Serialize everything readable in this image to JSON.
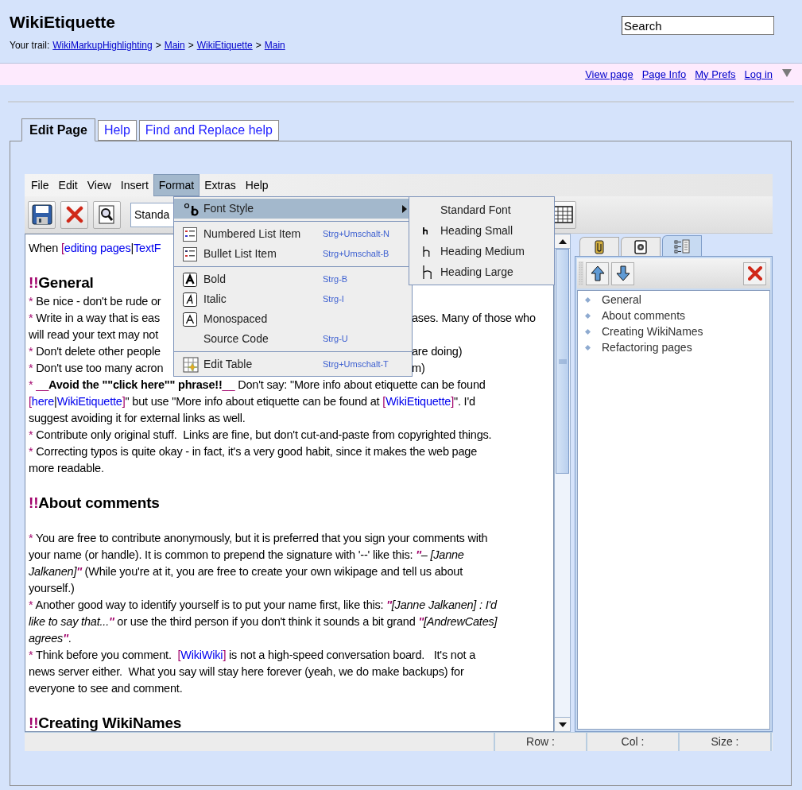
{
  "header": {
    "title": "WikiEtiquette",
    "search": {
      "value": "Search"
    }
  },
  "trail": {
    "label": "Your trail:",
    "items": [
      {
        "kind": "link",
        "text": "WikiMarkupHighlighting"
      },
      {
        "kind": "sep",
        "text": ">"
      },
      {
        "kind": "link",
        "text": "Main"
      },
      {
        "kind": "sep",
        "text": ">"
      },
      {
        "kind": "link",
        "text": "WikiEtiquette"
      },
      {
        "kind": "sep",
        "text": ">"
      },
      {
        "kind": "link",
        "text": "Main"
      }
    ]
  },
  "action_links": [
    "View page",
    "Page Info",
    "My Prefs",
    "Log in"
  ],
  "tabs": [
    {
      "label": "Edit Page",
      "selected": true
    },
    {
      "label": "Help",
      "selected": false
    },
    {
      "label": "Find and Replace help",
      "selected": false
    }
  ],
  "editor": {
    "menubar": [
      {
        "label": "File",
        "selected": false
      },
      {
        "label": "Edit",
        "selected": false
      },
      {
        "label": "View",
        "selected": false
      },
      {
        "label": "Insert",
        "selected": false
      },
      {
        "label": "Format",
        "selected": true
      },
      {
        "label": "Extras",
        "selected": false
      },
      {
        "label": "Help",
        "selected": false
      }
    ],
    "style_combo": "Standa",
    "format_menu": [
      {
        "kind": "font-style",
        "label": "Font Style",
        "selected": true
      },
      {
        "kind": "separator"
      },
      {
        "kind": "numbered",
        "label": "Numbered List Item",
        "shortcut": "Strg+Umschalt-N",
        "selected": false
      },
      {
        "kind": "bullet",
        "label": "Bullet List Item",
        "shortcut": "Strg+Umschalt-B",
        "selected": false
      },
      {
        "kind": "separator"
      },
      {
        "kind": "bold",
        "label": "Bold",
        "shortcut": "Strg-B",
        "selected": false
      },
      {
        "kind": "italic",
        "label": "Italic",
        "shortcut": "Strg-I",
        "selected": false
      },
      {
        "kind": "mono",
        "label": "Monospaced",
        "selected": false
      },
      {
        "kind": "plain",
        "label": "Source Code",
        "shortcut": "Strg-U",
        "selected": false
      },
      {
        "kind": "separator"
      },
      {
        "kind": "table",
        "label": "Edit Table",
        "shortcut": "Strg+Umschalt-T",
        "selected": false
      }
    ],
    "font_submenu": [
      {
        "kind": "standard",
        "label": "Standard Font"
      },
      {
        "kind": "small",
        "label": "Heading Small"
      },
      {
        "kind": "medium",
        "label": "Heading Medium"
      },
      {
        "kind": "large",
        "label": "Heading Large"
      }
    ],
    "lines": [
      {
        "kind": "text",
        "runs": [
          {
            "kind": "plain",
            "text": "When "
          },
          {
            "kind": "mark",
            "text": "["
          },
          {
            "kind": "link",
            "text": "editing pages"
          },
          {
            "kind": "plain",
            "text": "|"
          },
          {
            "kind": "link",
            "text": "TextF"
          }
        ]
      },
      {
        "kind": "blank"
      },
      {
        "kind": "heading",
        "runs": [
          {
            "kind": "mark",
            "text": "!!"
          },
          {
            "kind": "plain",
            "text": "General"
          }
        ]
      },
      {
        "kind": "text",
        "runs": [
          {
            "kind": "mark",
            "text": "*"
          },
          {
            "kind": "plain",
            "text": " Be nice - don't be rude or"
          }
        ]
      },
      {
        "kind": "text",
        "runs": [
          {
            "kind": "mark",
            "text": "*"
          },
          {
            "kind": "plain",
            "text": " Write in a way that is eas"
          }
        ],
        "right": [
          {
            "kind": "plain",
            "text": "ases. Many of those who"
          }
        ]
      },
      {
        "kind": "text",
        "runs": [
          {
            "kind": "plain",
            "text": "will read your text may not"
          }
        ]
      },
      {
        "kind": "text",
        "runs": [
          {
            "kind": "mark",
            "text": "*"
          },
          {
            "kind": "plain",
            "text": " Don't delete other people"
          }
        ],
        "right": [
          {
            "kind": "plain",
            "text": "are doing)"
          }
        ]
      },
      {
        "kind": "text",
        "runs": [
          {
            "kind": "mark",
            "text": "*"
          },
          {
            "kind": "plain",
            "text": " Don't use too many acron"
          }
        ],
        "right": [
          {
            "kind": "plain",
            "text": "m)"
          }
        ]
      },
      {
        "kind": "text",
        "runs": [
          {
            "kind": "mark",
            "text": "* __"
          },
          {
            "kind": "bold",
            "text": "Avoid the \"\"click here\"\" phrase!!"
          },
          {
            "kind": "mark",
            "text": "__"
          },
          {
            "kind": "plain",
            "text": " Don't say: \"More info about etiquette can be found"
          }
        ]
      },
      {
        "kind": "text",
        "runs": [
          {
            "kind": "mark",
            "text": "["
          },
          {
            "kind": "link",
            "text": "here"
          },
          {
            "kind": "plain",
            "text": "|"
          },
          {
            "kind": "link",
            "text": "WikiEtiquette"
          },
          {
            "kind": "mark",
            "text": "]"
          },
          {
            "kind": "plain",
            "text": "\" but use \"More info about etiquette can be found at "
          },
          {
            "kind": "mark",
            "text": "["
          },
          {
            "kind": "link",
            "text": "WikiEtiquette"
          },
          {
            "kind": "mark",
            "text": "]"
          },
          {
            "kind": "plain",
            "text": "\". I'd"
          }
        ]
      },
      {
        "kind": "text",
        "runs": [
          {
            "kind": "plain",
            "text": "suggest avoiding it for external links as well."
          }
        ]
      },
      {
        "kind": "text",
        "runs": [
          {
            "kind": "mark",
            "text": "*"
          },
          {
            "kind": "plain",
            "text": " Contribute only original stuff.  Links are fine, but don't cut-and-paste from copyrighted things."
          }
        ]
      },
      {
        "kind": "text",
        "runs": [
          {
            "kind": "mark",
            "text": "*"
          },
          {
            "kind": "plain",
            "text": " Correcting typos is quite okay - in fact, it's a very good habit, since it makes the web page"
          }
        ]
      },
      {
        "kind": "text",
        "runs": [
          {
            "kind": "plain",
            "text": "more readable."
          }
        ]
      },
      {
        "kind": "blank"
      },
      {
        "kind": "heading",
        "runs": [
          {
            "kind": "mark",
            "text": "!!"
          },
          {
            "kind": "plain",
            "text": "About comments"
          }
        ]
      },
      {
        "kind": "blank"
      },
      {
        "kind": "text",
        "runs": [
          {
            "kind": "mark",
            "text": "*"
          },
          {
            "kind": "plain",
            "text": " You are free to contribute anonymously, but it is preferred that you sign your comments with"
          }
        ]
      },
      {
        "kind": "text",
        "runs": [
          {
            "kind": "plain",
            "text": "your name (or handle). It is common to prepend the signature with '--' like this: "
          },
          {
            "kind": "mark-italic",
            "text": "''"
          },
          {
            "kind": "italic",
            "text": "– [Janne"
          }
        ]
      },
      {
        "kind": "text",
        "runs": [
          {
            "kind": "italic",
            "text": "Jalkanen]"
          },
          {
            "kind": "mark-italic",
            "text": "''"
          },
          {
            "kind": "plain",
            "text": " (While you're at it, you are free to create your own wikipage and tell us about"
          }
        ]
      },
      {
        "kind": "text",
        "runs": [
          {
            "kind": "plain",
            "text": "yourself.)"
          }
        ]
      },
      {
        "kind": "text",
        "runs": [
          {
            "kind": "mark",
            "text": "*"
          },
          {
            "kind": "plain",
            "text": " Another good way to identify yourself is to put your name first, like this: "
          },
          {
            "kind": "mark-italic",
            "text": "''"
          },
          {
            "kind": "italic",
            "text": "[Janne Jalkanen] : I'd"
          }
        ]
      },
      {
        "kind": "text",
        "runs": [
          {
            "kind": "italic",
            "text": "like to say that..."
          },
          {
            "kind": "mark-italic",
            "text": "''"
          },
          {
            "kind": "plain",
            "text": " or use the third person if you don't think it sounds a bit grand "
          },
          {
            "kind": "mark-italic",
            "text": "''"
          },
          {
            "kind": "italic",
            "text": "[AndrewCates]"
          }
        ]
      },
      {
        "kind": "text",
        "runs": [
          {
            "kind": "italic",
            "text": "agrees"
          },
          {
            "kind": "mark-italic",
            "text": "''"
          },
          {
            "kind": "plain",
            "text": "."
          }
        ]
      },
      {
        "kind": "text",
        "runs": [
          {
            "kind": "mark",
            "text": "*"
          },
          {
            "kind": "plain",
            "text": " Think before you comment.  "
          },
          {
            "kind": "mark",
            "text": "["
          },
          {
            "kind": "link",
            "text": "WikiWiki"
          },
          {
            "kind": "mark",
            "text": "]"
          },
          {
            "kind": "plain",
            "text": " is not a high-speed conversation board.   It's not a"
          }
        ]
      },
      {
        "kind": "text",
        "runs": [
          {
            "kind": "plain",
            "text": "news server either.  What you say will stay here forever (yeah, we do make backups) for"
          }
        ]
      },
      {
        "kind": "text",
        "runs": [
          {
            "kind": "plain",
            "text": "everyone to see and comment."
          }
        ]
      },
      {
        "kind": "blank"
      },
      {
        "kind": "heading",
        "runs": [
          {
            "kind": "mark",
            "text": "!!"
          },
          {
            "kind": "plain",
            "text": "Creating WikiNames"
          }
        ]
      }
    ],
    "side_tabs": [
      {
        "kind": "attachments",
        "selected": false
      },
      {
        "kind": "settings",
        "selected": false
      },
      {
        "kind": "outline",
        "selected": true
      }
    ],
    "outline": [
      "General",
      "About comments",
      "Creating WikiNames",
      "Refactoring pages"
    ],
    "status": [
      "Row :",
      "Col :",
      "Size :"
    ]
  }
}
